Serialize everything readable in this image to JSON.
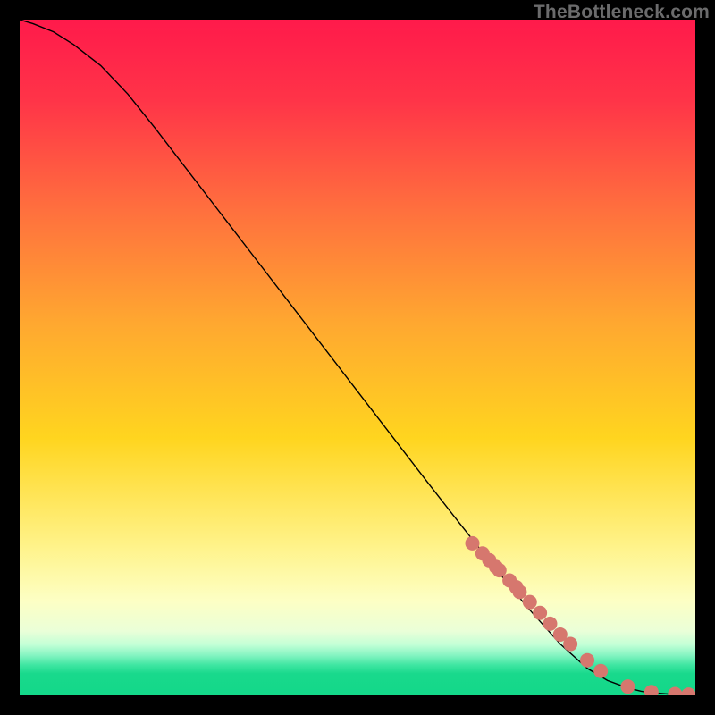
{
  "watermark": "TheBottleneck.com",
  "chart_data": {
    "type": "line",
    "title": "",
    "xlabel": "",
    "ylabel": "",
    "xlim": [
      0,
      100
    ],
    "ylim": [
      0,
      100
    ],
    "grid": false,
    "legend": false,
    "background_gradient": {
      "stops": [
        {
          "pos": 0.0,
          "color": "#ff1a4b"
        },
        {
          "pos": 0.12,
          "color": "#ff3448"
        },
        {
          "pos": 0.28,
          "color": "#ff6f3e"
        },
        {
          "pos": 0.45,
          "color": "#ffa830"
        },
        {
          "pos": 0.62,
          "color": "#ffd51f"
        },
        {
          "pos": 0.78,
          "color": "#fff38a"
        },
        {
          "pos": 0.86,
          "color": "#fdffc4"
        },
        {
          "pos": 0.905,
          "color": "#eaffd8"
        },
        {
          "pos": 0.925,
          "color": "#c2ffd6"
        },
        {
          "pos": 0.94,
          "color": "#88f5c3"
        },
        {
          "pos": 0.955,
          "color": "#3fe6a2"
        },
        {
          "pos": 0.968,
          "color": "#19d98c"
        },
        {
          "pos": 1.0,
          "color": "#13d889"
        }
      ]
    },
    "series": [
      {
        "name": "curve",
        "type": "line",
        "stroke": "#000000",
        "stroke_width": 1.4,
        "x": [
          0,
          2,
          5,
          8,
          12,
          16,
          20,
          25,
          30,
          35,
          40,
          45,
          50,
          55,
          60,
          65,
          70,
          75,
          80,
          84,
          87,
          90,
          92,
          94,
          96,
          98,
          100
        ],
        "y": [
          100,
          99.4,
          98.2,
          96.3,
          93.2,
          89.0,
          84.0,
          77.5,
          71.0,
          64.5,
          58.0,
          51.5,
          45.0,
          38.5,
          32.0,
          25.6,
          19.3,
          13.2,
          7.6,
          4.0,
          2.2,
          1.1,
          0.6,
          0.35,
          0.2,
          0.12,
          0.1
        ]
      },
      {
        "name": "markers",
        "type": "scatter",
        "marker_color": "#d6776e",
        "marker_radius": 8,
        "x": [
          67,
          68.5,
          69.5,
          70.5,
          71,
          72.5,
          73.5,
          74.0,
          75.5,
          77.0,
          78.5,
          80.0,
          81.5,
          84.0,
          86.0,
          90.0,
          93.5,
          97.0,
          99.0
        ],
        "y": [
          22.5,
          21.0,
          20.0,
          19.0,
          18.5,
          17.0,
          16.0,
          15.3,
          13.8,
          12.2,
          10.6,
          9.0,
          7.6,
          5.2,
          3.6,
          1.3,
          0.5,
          0.2,
          0.12
        ]
      }
    ]
  }
}
